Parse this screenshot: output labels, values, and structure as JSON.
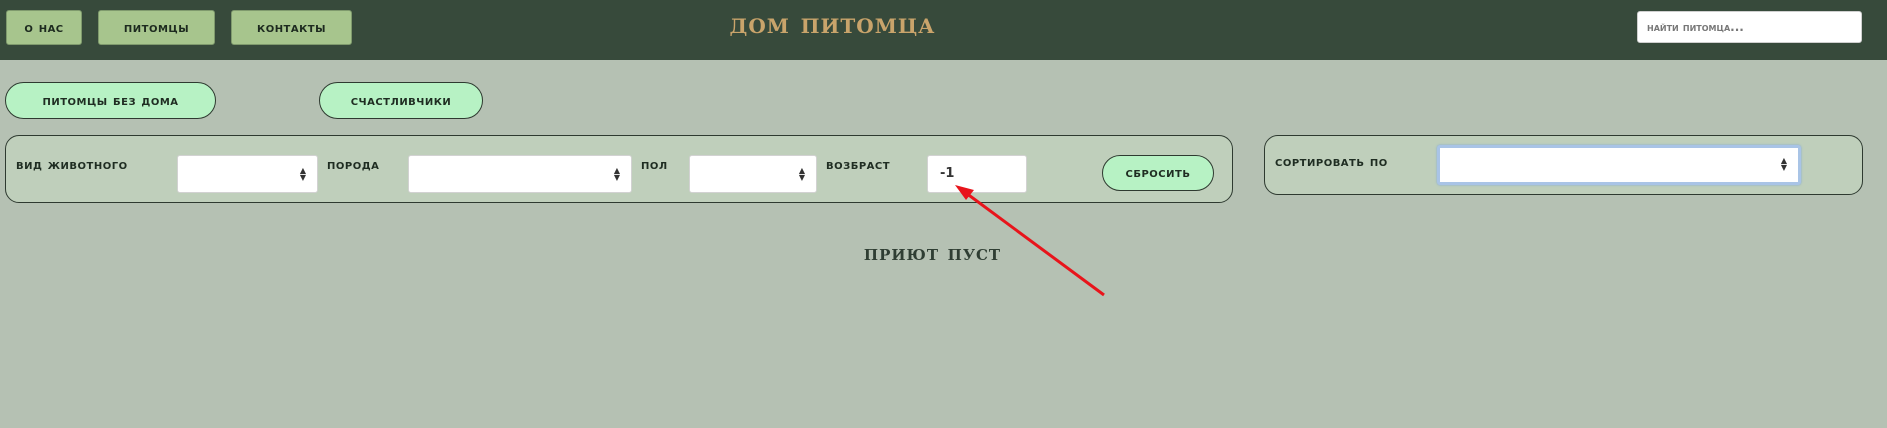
{
  "header": {
    "nav": [
      {
        "label": "О нас"
      },
      {
        "label": "питомцы"
      },
      {
        "label": "контакты"
      }
    ],
    "title": "ДОМ ПИТОМЦА",
    "search": {
      "placeholder": "найти питомца...",
      "value": ""
    }
  },
  "tabs": [
    {
      "label": "питомцы без дома"
    },
    {
      "label": "счастливчики"
    }
  ],
  "filters": {
    "animal_type_label": "вид животного",
    "breed_label": "порода",
    "sex_label": "пол",
    "age_label": "возбраст",
    "age_value": "-1",
    "reset_label": "сбросить"
  },
  "sort": {
    "label": "сортировать по",
    "value": ""
  },
  "main": {
    "empty_message": "ПРИЮТ ПУСТ"
  },
  "colors": {
    "header_bg": "#374a3b",
    "page_bg": "#b5c1b3",
    "accent_green": "#b7f2c4",
    "nav_button": "#a7c58d",
    "title_gold": "#c9a46b",
    "annotation_red": "#e8141b"
  }
}
